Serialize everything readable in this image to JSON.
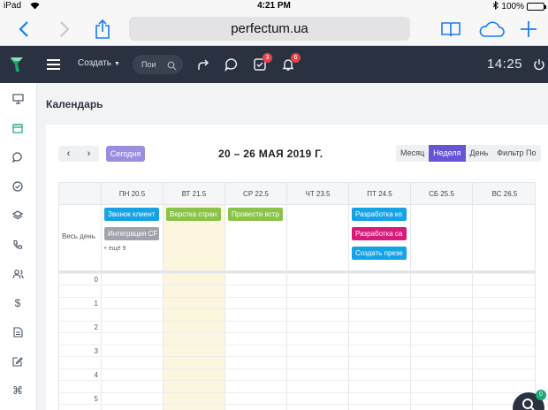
{
  "status_bar": {
    "device": "iPad",
    "time": "4:21 PM",
    "battery": "100%"
  },
  "browser": {
    "url": "perfectum.ua"
  },
  "header": {
    "create_label": "Создать",
    "search_placeholder": "Пои",
    "tasks_badge": "3",
    "notifications_badge": "6",
    "clock": "14:25"
  },
  "page": {
    "title": "Календарь"
  },
  "calendar": {
    "today_label": "Сегодня",
    "range": "20 – 26 МАЯ 2019 Г.",
    "views": [
      "Месяц",
      "Неделя",
      "День",
      "Фильтр По"
    ],
    "days": [
      "ПН 20.5",
      "ВТ 21.5",
      "СР 22.5",
      "ЧТ 23.5",
      "ПТ 24.5",
      "СБ 25.5",
      "ВС 26.5"
    ],
    "all_day_label": "Весь день",
    "more_label": "+ ещё 9",
    "events": [
      {
        "title": "Звонок клиент",
        "color": "#16a3e6"
      },
      {
        "title": "Интеграция CF",
        "color": "#a0a4aa"
      },
      {
        "title": "Верстка стран",
        "color": "#8bc34a"
      },
      {
        "title": "Провести встр",
        "color": "#8bc34a"
      },
      {
        "title": "Разработка ко",
        "color": "#16a3e6"
      },
      {
        "title": "Разработка са",
        "color": "#d81b7a"
      },
      {
        "title": "Создать презе",
        "color": "#16a3e6"
      }
    ],
    "hours": [
      "0",
      "1",
      "2",
      "3",
      "4",
      "5"
    ]
  },
  "colors": {
    "header_bg": "#2a3140",
    "accent": "#6653d5",
    "today_col": "#fdf6de",
    "brand_green": "#19a974"
  }
}
